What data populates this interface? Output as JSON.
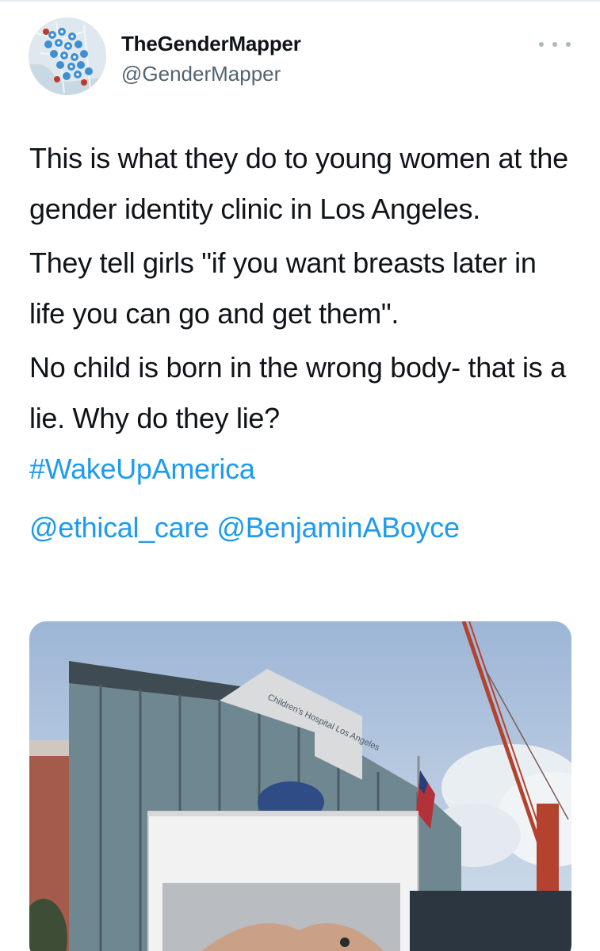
{
  "user": {
    "display_name": "TheGenderMapper",
    "handle": "@GenderMapper",
    "avatar_icon": "map-pins-avatar-icon"
  },
  "more_icon": "more-horizontal-icon",
  "tweet": {
    "paragraph_1": "This is what they do to young women at the gender identity clinic in Los Angeles.",
    "paragraph_2": "They tell girls \"if you want breasts later in life you can go and get them\".",
    "paragraph_3": "No child is born in the wrong body- that is a lie. Why do they lie?",
    "hashtag": "#WakeUpAmerica",
    "mention_1": "@ethical_care",
    "mention_2": "@BenjaminABoyce"
  },
  "media": {
    "building_sign": "Children's Hospital Los Angeles"
  },
  "colors": {
    "link": "#1d9bf0",
    "text": "#0f1419",
    "secondary": "#536471"
  }
}
